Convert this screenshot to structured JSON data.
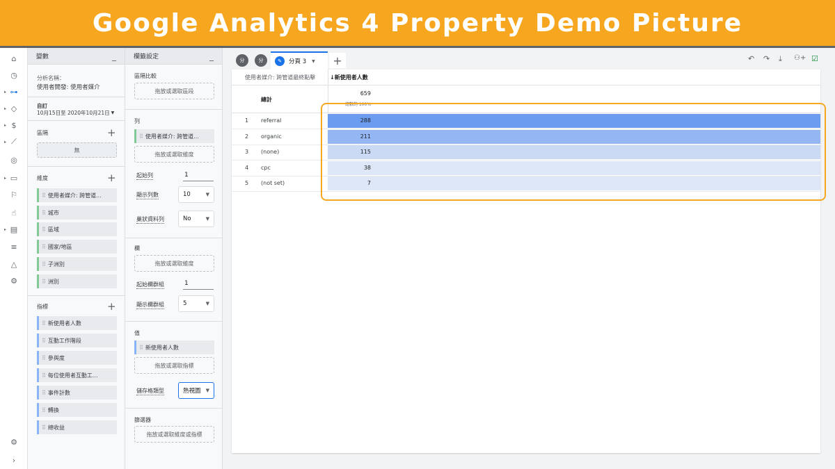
{
  "banner": {
    "title": "Google Analytics 4 Property Demo Picture"
  },
  "variables_panel": {
    "title": "變數",
    "analysis_name_label": "分析名稱：",
    "analysis_name_value": "使用者開發: 使用者媒介",
    "date_preset": "自訂",
    "date_range": "10月15日至 2020年10月21日",
    "segments_label": "區隔",
    "segments_empty": "無",
    "dimensions_label": "維度",
    "dimensions": [
      "使用者媒介: 跨管道...",
      "城市",
      "區域",
      "國家/地區",
      "子洲別",
      "洲別"
    ],
    "metrics_label": "指標",
    "metrics": [
      "新使用者人數",
      "互動工作階段",
      "參與度",
      "每位使用者互動工...",
      "事件計數",
      "轉換",
      "總收益"
    ]
  },
  "tab_settings_panel": {
    "title": "欄籤設定",
    "segment_compare_label": "區隔比較",
    "segment_drop": "拖放或選取區段",
    "rows_label": "列",
    "rows_chip": "使用者媒介: 跨管道...",
    "rows_drop": "拖放或選取維度",
    "start_row_label": "起始列",
    "start_row_value": "1",
    "show_rows_label": "顯示列數",
    "show_rows_value": "10",
    "nested_rows_label": "巢狀資料列",
    "nested_rows_value": "No",
    "columns_label": "欄",
    "columns_drop": "拖放或選取維度",
    "start_col_label": "起始欄群組",
    "start_col_value": "1",
    "show_col_label": "顯示欄群組",
    "show_col_value": "5",
    "values_label": "值",
    "values_chip": "新使用者人數",
    "values_drop": "拖放或選取指標",
    "cell_type_label": "儲存格類型",
    "cell_type_value": "熱視圖",
    "filters_label": "篩選器",
    "filters_drop": "拖放或選取維度或指標"
  },
  "tabs": {
    "tab1": "分",
    "tab2": "分",
    "active": "分頁 3"
  },
  "icons": [
    "home-icon",
    "clock-icon",
    "explore-icon",
    "tag-icon",
    "dollar-icon",
    "wand-icon",
    "globe-icon",
    "devices-icon",
    "flag-icon",
    "touch-icon",
    "report-icon",
    "users-icon",
    "shapes-icon",
    "bug-icon",
    "settings-icon",
    "undo-icon",
    "redo-icon",
    "download-icon",
    "share-icon",
    "check-icon"
  ],
  "table": {
    "dim_header": "使用者媒介: 跨管道最終點擊",
    "metric_header": "↓新使用者人數",
    "total_label": "總計",
    "total_value": "659",
    "total_pct": "總數的 100%",
    "rows": [
      {
        "idx": "1",
        "name": "referral",
        "value": "288"
      },
      {
        "idx": "2",
        "name": "organic",
        "value": "211"
      },
      {
        "idx": "3",
        "name": "(none)",
        "value": "115"
      },
      {
        "idx": "4",
        "name": "cpc",
        "value": "38"
      },
      {
        "idx": "5",
        "name": "(not set)",
        "value": "7"
      }
    ]
  },
  "colors": {
    "accent": "#f6a71f",
    "heat_high": "#6c9cf0",
    "heat_mid": "#94b7f3",
    "heat_low": "#cbdaf4",
    "heat_min": "#dde7f7"
  }
}
